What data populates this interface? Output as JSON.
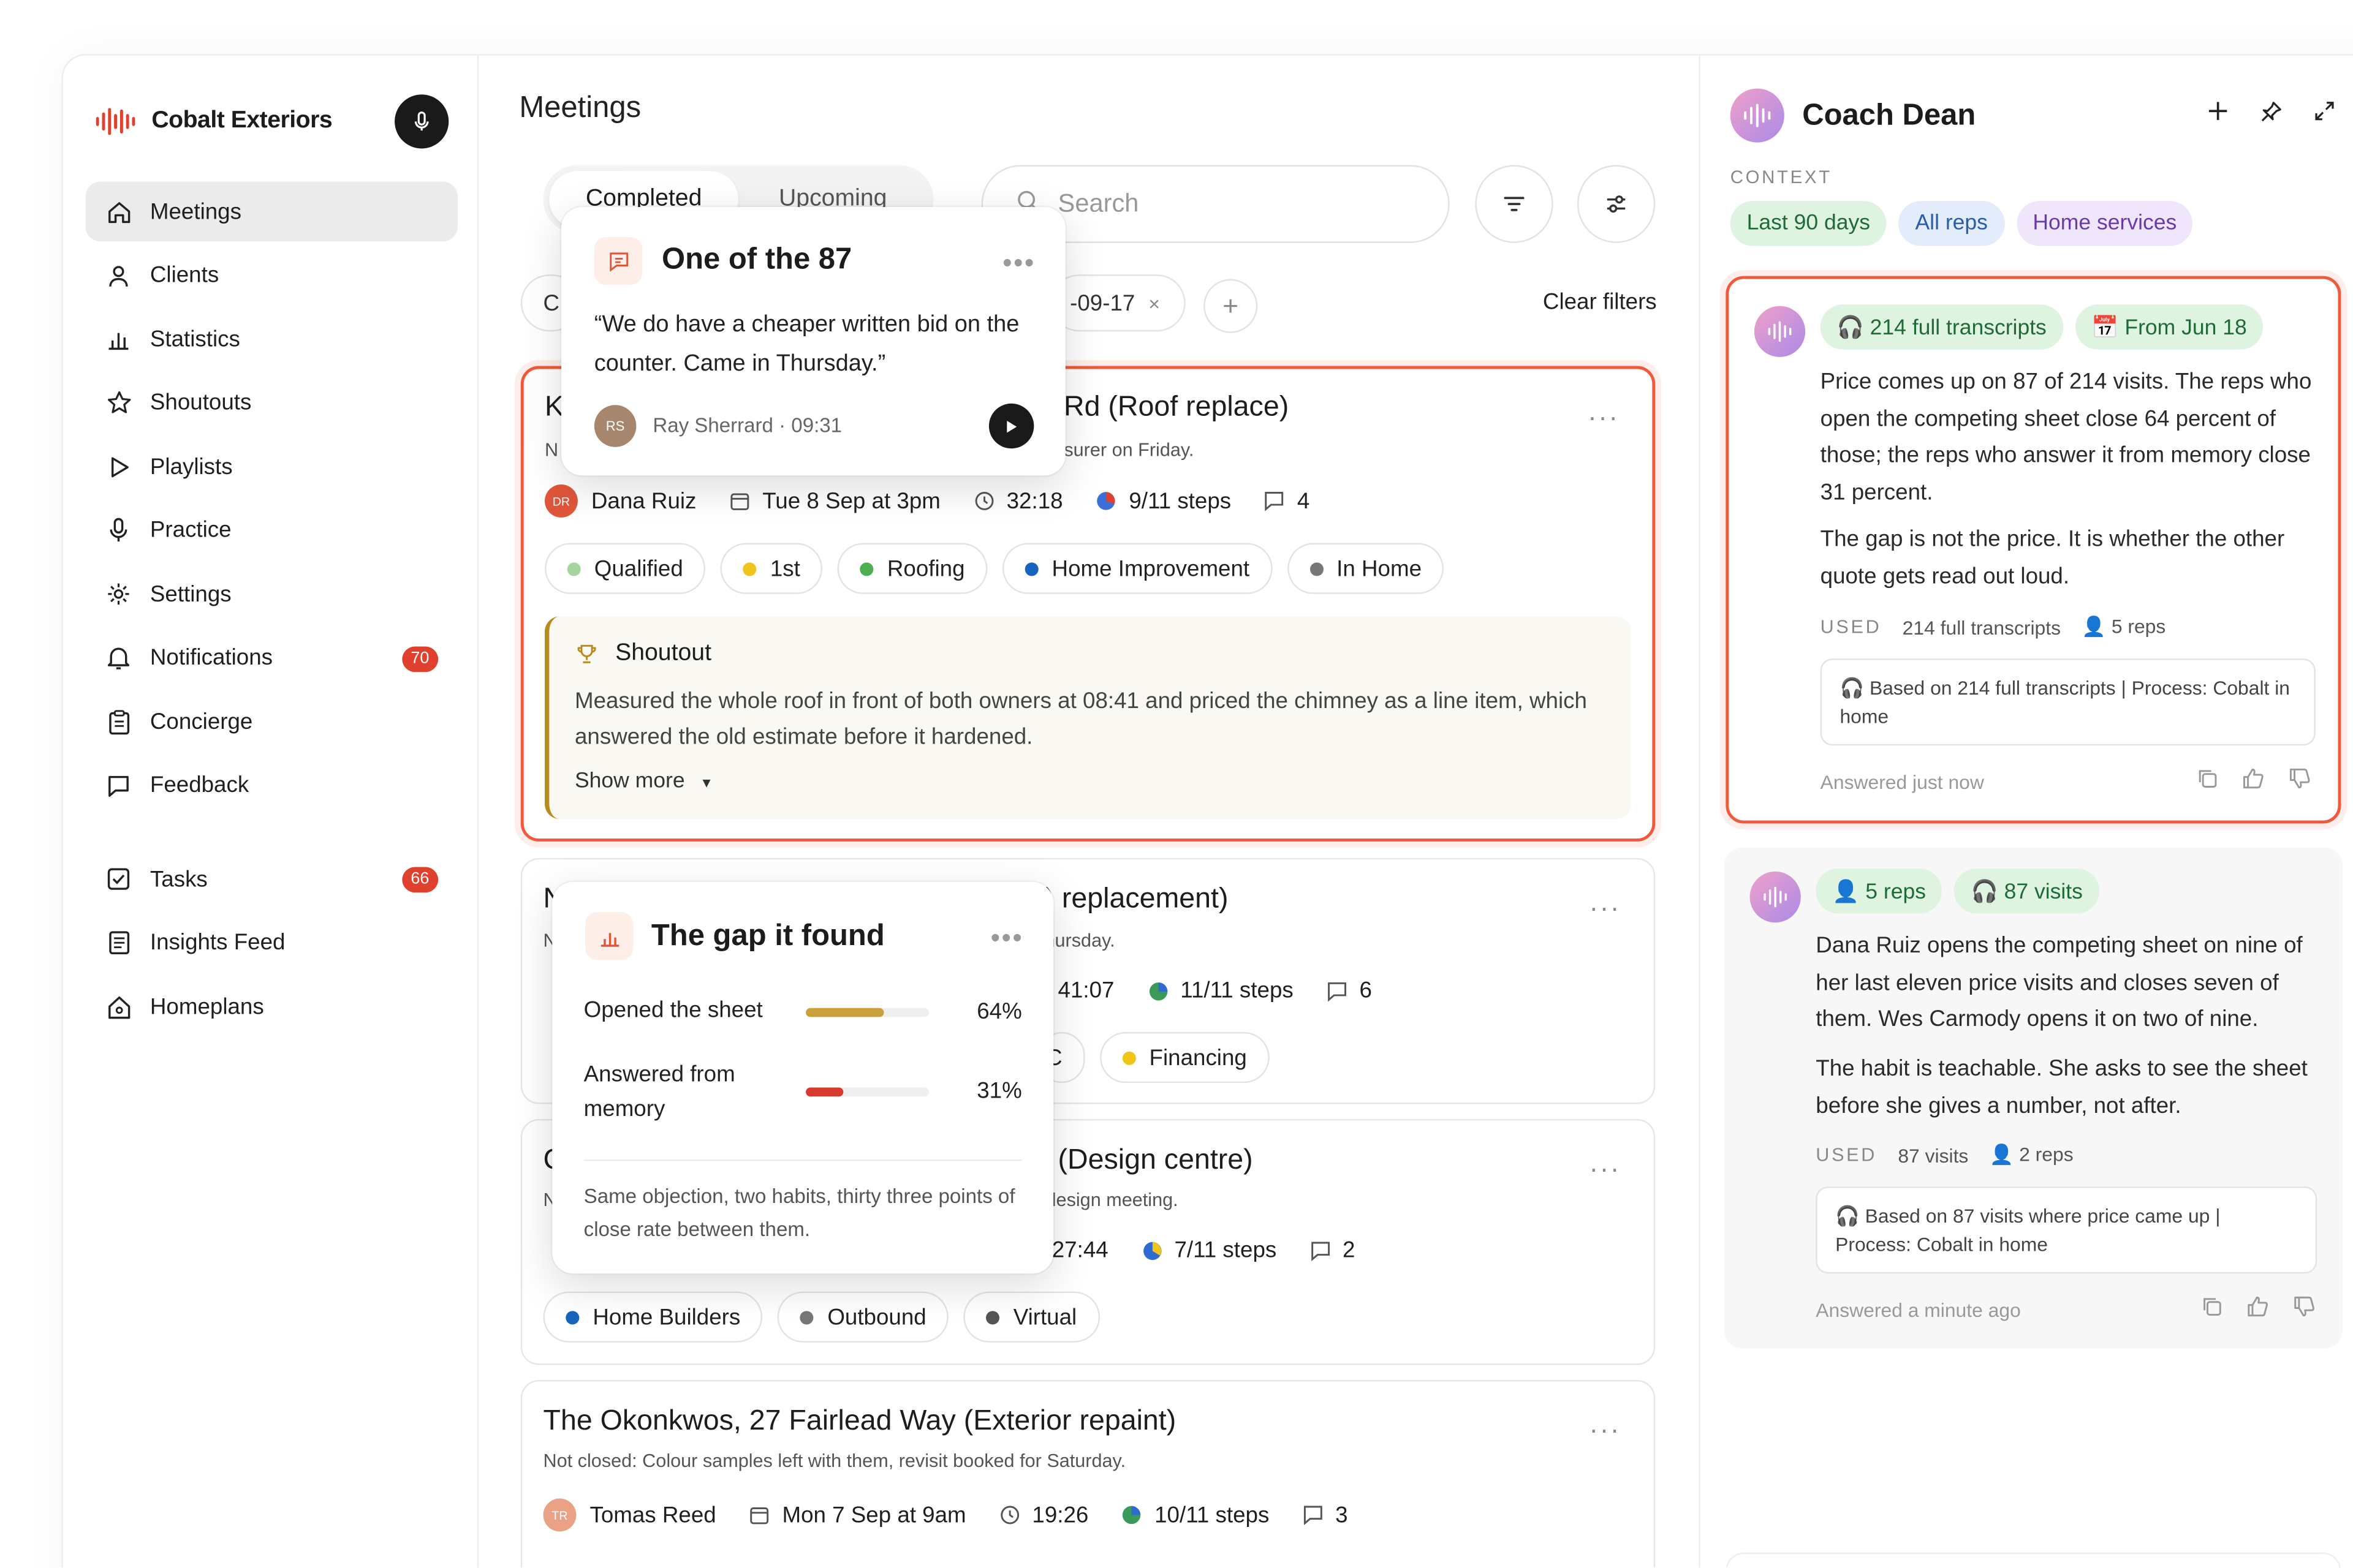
{
  "brand": {
    "name": "Cobalt Exteriors"
  },
  "nav": {
    "items": [
      {
        "label": "Meetings",
        "icon": "home-icon"
      },
      {
        "label": "Clients",
        "icon": "user-icon"
      },
      {
        "label": "Statistics",
        "icon": "bar-chart-icon"
      },
      {
        "label": "Shoutouts",
        "icon": "star-icon"
      },
      {
        "label": "Playlists",
        "icon": "play-icon"
      },
      {
        "label": "Practice",
        "icon": "mic-icon"
      },
      {
        "label": "Settings",
        "icon": "gear-icon"
      },
      {
        "label": "Notifications",
        "icon": "bell-icon",
        "badge": "70"
      },
      {
        "label": "Concierge",
        "icon": "clipboard-icon"
      },
      {
        "label": "Feedback",
        "icon": "chat-icon"
      }
    ],
    "items2": [
      {
        "label": "Tasks",
        "icon": "checkbox-icon",
        "badge": "66"
      },
      {
        "label": "Insights Feed",
        "icon": "feed-icon"
      },
      {
        "label": "Homeplans",
        "icon": "house-icon"
      }
    ]
  },
  "main": {
    "title": "Meetings",
    "tabs": [
      "Completed",
      "Upcoming"
    ],
    "search_placeholder": "Search",
    "filter_chip_left": "C",
    "filter_chip_date": "-09-17",
    "clear_filters": "Clear filters"
  },
  "cards": [
    {
      "title_left": "K",
      "title_right": "d Rd (Roof replace)",
      "sub_left": "N",
      "sub_right": "surer on Friday.",
      "rep": "Dana Ruiz",
      "rep_initials": "DR",
      "date": "Tue 8 Sep at 3pm",
      "duration": "32:18",
      "steps": "9/11 steps",
      "comments": "4",
      "tags": [
        {
          "label": "Qualified",
          "color": "#a6d49f"
        },
        {
          "label": "1st",
          "color": "#f0c419"
        },
        {
          "label": "Roofing",
          "color": "#4caf50"
        },
        {
          "label": "Home Improvement",
          "color": "#1565c0"
        },
        {
          "label": "In Home",
          "color": "#777777"
        }
      ],
      "shoutout": {
        "title": "Shoutout",
        "body": "Measured the whole roof in front of both owners at 08:41 and priced the chimney as a line item, which answered the old estimate before it hardened.",
        "show_more": "Show more"
      }
    },
    {
      "title_left": "N",
      "title_right": ") replacement)",
      "sub_left": "N",
      "sub_right": "hursday.",
      "duration": "41:07",
      "steps": "11/11 steps",
      "comments": "6",
      "tags_right": [
        {
          "label": "C",
          "color": ""
        },
        {
          "label": "Financing",
          "color": "#f0c419"
        }
      ]
    },
    {
      "title_left": "C",
      "title_right": "(Design centre)",
      "sub_left": "N",
      "sub_right": "lesign meeting.",
      "duration": "27:44",
      "steps": "7/11 steps",
      "comments": "2",
      "tags": [
        {
          "label": "Home Builders",
          "color": "#1565c0"
        },
        {
          "label": "Outbound",
          "color": "#777777"
        },
        {
          "label": "Virtual",
          "color": "#555555"
        }
      ]
    },
    {
      "title": "The Okonkwos, 27 Fairlead Way (Exterior repaint)",
      "sub": "Not closed: Colour samples left with them, revisit booked for Saturday.",
      "rep": "Tomas Reed",
      "rep_initials": "TR",
      "date": "Mon 7 Sep at 9am",
      "duration": "19:26",
      "steps": "10/11 steps",
      "comments": "3"
    }
  ],
  "pop_quote": {
    "title": "One of the 87",
    "quote": "“We do have a cheaper written bid on the counter. Came in Thursday.”",
    "initials": "RS",
    "speaker": "Ray Sherrard · 09:31"
  },
  "pop_gap": {
    "title": "The gap it found",
    "rows": [
      {
        "label": "Opened the sheet",
        "value": 0.64,
        "display": "64%",
        "color": "#c9a03a"
      },
      {
        "label": "Answered from memory",
        "value": 0.31,
        "display": "31%",
        "color": "#d93a2f"
      }
    ],
    "note": "Same objection, two habits, thirty three points of close rate between them."
  },
  "coach": {
    "name": "Coach Dean",
    "context_label": "CONTEXT",
    "chips": [
      {
        "label": "Last 90 days",
        "bg": "#dff3e1",
        "fg": "#1f6a36"
      },
      {
        "label": "All reps",
        "bg": "#e3ecfb",
        "fg": "#2a5cae"
      },
      {
        "label": "Home services",
        "bg": "#efe6fb",
        "fg": "#6a3aa8"
      }
    ],
    "answers": [
      {
        "pills": [
          "🎧 214 full transcripts",
          "📅 From Jun 18"
        ],
        "p1": "Price comes up on 87 of 214 visits. The reps who open the competing sheet close 64 percent of those; the reps who answer it from memory close 31 percent.",
        "p2": "The gap is not the price. It is whether the other quote gets read out loud.",
        "used_label": "USED",
        "used_a": "214 full transcripts",
        "used_b": "👤 5 reps",
        "source": "🎧 Based on 214 full transcripts  |  Process: Cobalt in home",
        "footer": "Answered just now"
      },
      {
        "pills": [
          "👤 5 reps",
          "🎧 87 visits"
        ],
        "p1": "Dana Ruiz opens the competing sheet on nine of her last eleven price visits and closes seven of them. Wes Carmody opens it on two of nine.",
        "p2": "The habit is teachable. She asks to see the sheet before she gives a number, not after.",
        "used_label": "USED",
        "used_a": "87 visits",
        "used_b": "👤 2 reps",
        "source": "🎧 Based on 87 visits where price came up  |  Process: Cobalt in home",
        "footer": "Answered a minute ago"
      }
    ]
  }
}
